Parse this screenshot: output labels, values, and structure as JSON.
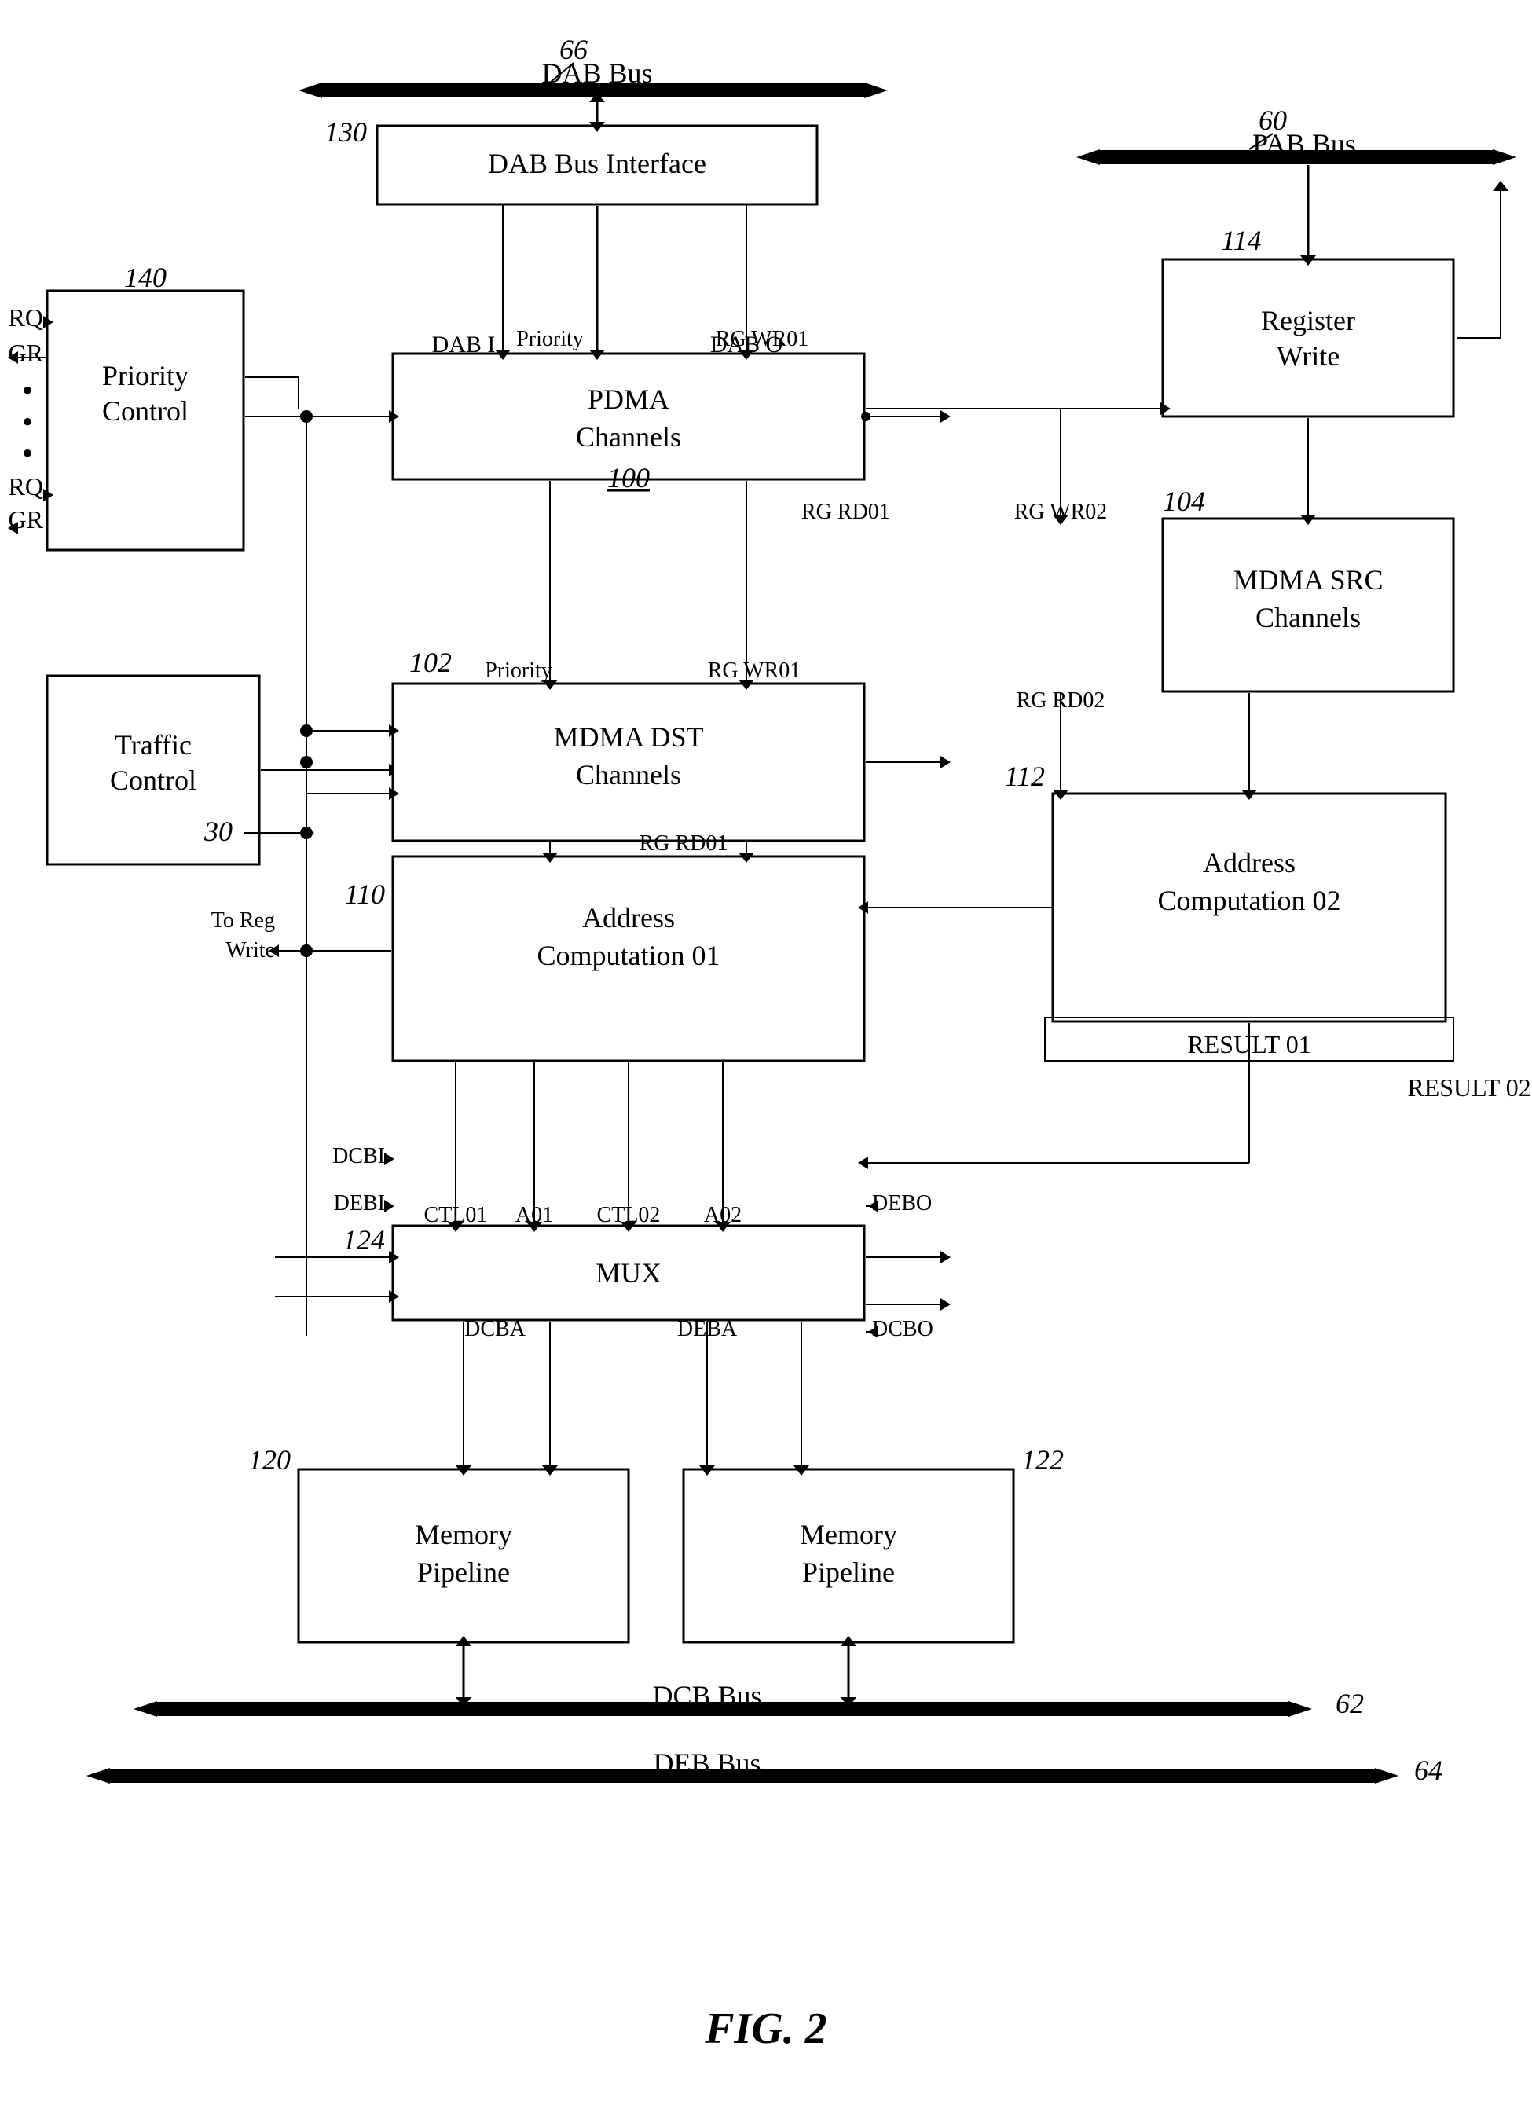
{
  "title": "FIG. 2",
  "diagram": {
    "buses": {
      "dab_bus": {
        "label": "DAB Bus",
        "ref": "66"
      },
      "pab_bus": {
        "label": "PAB Bus",
        "ref": "60"
      },
      "dcb_bus": {
        "label": "DCB Bus",
        "ref": "62"
      },
      "deb_bus": {
        "label": "DEB Bus",
        "ref": "64"
      }
    },
    "blocks": {
      "dab_bus_interface": {
        "label": "DAB Bus Interface",
        "ref": "130"
      },
      "priority_control": {
        "label": "Priority Control",
        "ref": "140"
      },
      "register_write": {
        "label": "Register Write",
        "ref": "114"
      },
      "pdma_channels": {
        "label": "PDMA Channels",
        "ref": "100"
      },
      "traffic_control": {
        "label": "Traffic Control"
      },
      "mdma_dst_channels": {
        "label": "MDMA DST Channels",
        "ref": "102"
      },
      "mdma_src_channels": {
        "label": "MDMA SRC Channels",
        "ref": "104"
      },
      "address_computation_01": {
        "label": "Address Computation 01",
        "ref": "110"
      },
      "address_computation_02": {
        "label": "Address Computation 02",
        "ref": "112"
      },
      "mux": {
        "label": "MUX",
        "ref": "124"
      },
      "memory_pipeline_1": {
        "label": "Memory Pipeline",
        "ref": "120"
      },
      "memory_pipeline_2": {
        "label": "Memory Pipeline",
        "ref": "122"
      }
    },
    "signals": {
      "dab_i": "DAB I",
      "dab_o": "DAB O",
      "priority": "Priority",
      "rg_wr01_1": "RG WR01",
      "rg_rd01_1": "RG RD01",
      "rg_wr01_2": "RG WR01",
      "rg_wr02": "RG WR02",
      "rg_rd02": "RG RD02",
      "rg_rd01_2": "RG RD01",
      "ctl01": "CTL01",
      "a01": "A01",
      "ctl02": "CTL02",
      "a02": "A02",
      "dcbi": "DCBI",
      "debi": "DEBI",
      "debo": "DEBO",
      "dcba": "DCBA",
      "deba": "DEBA",
      "dcbo": "DCBO",
      "result_01": "RESULT 01",
      "result_02": "RESULT 02",
      "to_reg_write": "To Reg Write",
      "rq_top": "RQ",
      "gr_top": "GR",
      "rq_bottom": "RQ",
      "gr_bottom": "GR",
      "ref_30": "30"
    },
    "figure_label": "FIG. 2"
  }
}
